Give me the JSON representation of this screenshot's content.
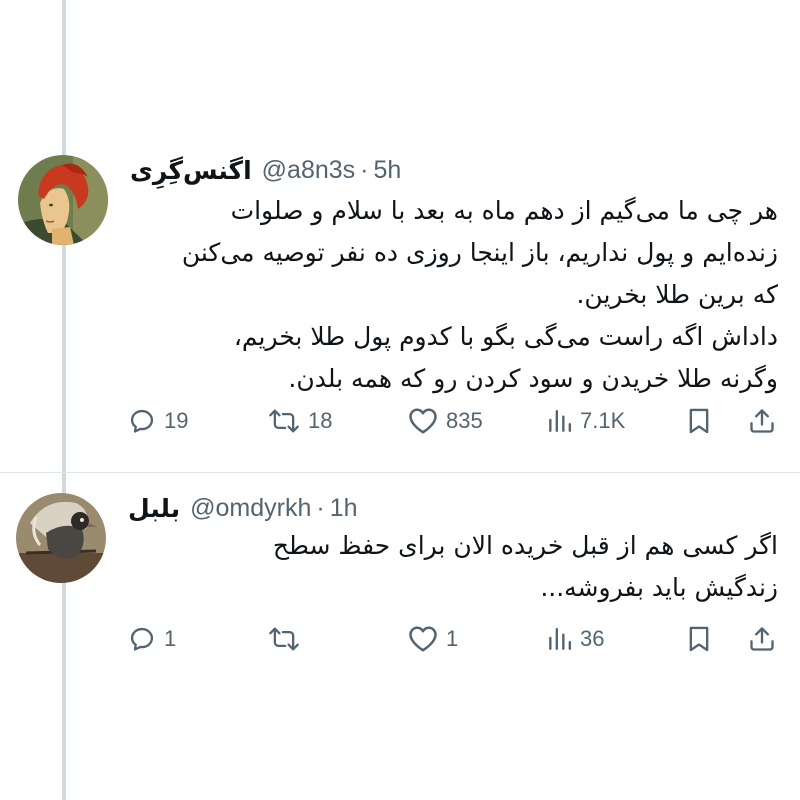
{
  "tweets": [
    {
      "display_name": "اگنس‌گِرِی",
      "handle": "@a8n3s",
      "separator": "·",
      "time": "5h",
      "avatar": "portrait-avatar-red-hair",
      "lines": [
        "هر چی ما می‌گیم از دهم ماه به بعد با سلام و صلوات",
        "زنده‌ایم و پول نداریم، باز اینجا روزی ده نفر توصیه می‌کنن",
        "که برین طلا بخرین.",
        "داداش اگه راست می‌گی بگو با کدوم پول طلا بخریم،",
        "وگرنه طلا خریدن و سود کردن رو که همه بلدن."
      ],
      "replies": "19",
      "retweets": "18",
      "likes": "835",
      "views": "7.1K"
    },
    {
      "display_name": "بلبل",
      "handle": "@omdyrkh",
      "separator": "·",
      "time": "1h",
      "avatar": "bird-avatar",
      "lines": [
        "اگر کسی هم از قبل خریده الان برای حفظ سطح",
        "زندگیش باید بفروشه..."
      ],
      "replies": "1",
      "retweets": "",
      "likes": "1",
      "views": "36"
    }
  ],
  "icons": {
    "reply": "speech-bubble-icon",
    "retweet": "retweet-arrows-icon",
    "like": "heart-icon",
    "views": "bar-chart-icon",
    "bookmark": "bookmark-icon",
    "share": "share-upload-icon"
  },
  "colors": {
    "text_primary": "#0f1419",
    "text_secondary": "#536471",
    "thread_line": "#cfd9de"
  }
}
